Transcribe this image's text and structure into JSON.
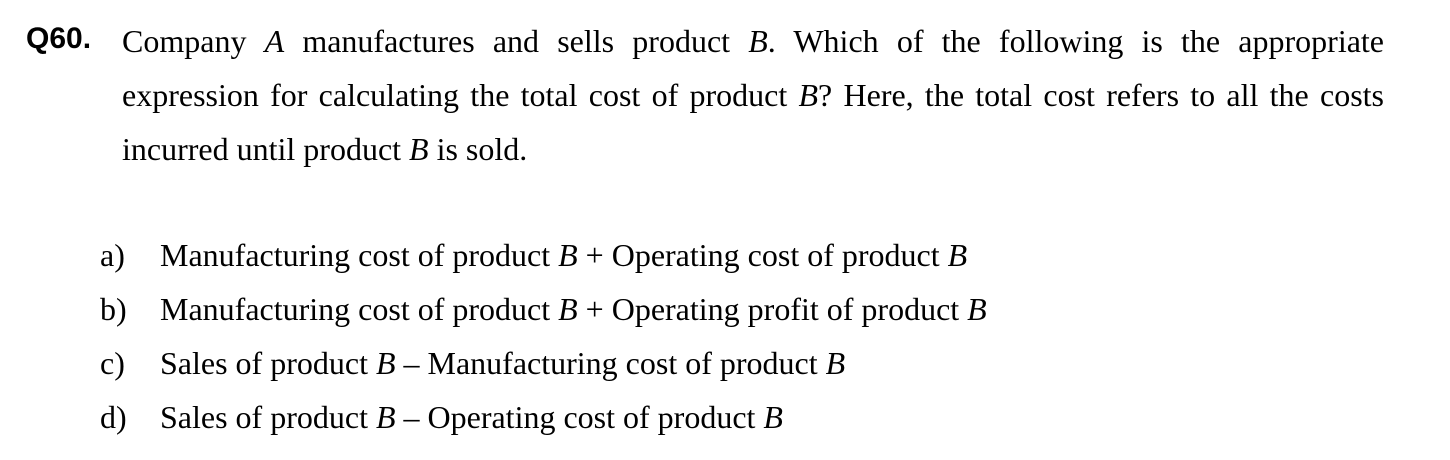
{
  "question": {
    "number": "Q60.",
    "stem_parts": [
      {
        "text": "Company ",
        "italic": false
      },
      {
        "text": "A",
        "italic": true
      },
      {
        "text": " manufactures and sells product ",
        "italic": false
      },
      {
        "text": "B",
        "italic": true
      },
      {
        "text": ".  Which of the following is the appropriate expression for calculating the total cost of product ",
        "italic": false
      },
      {
        "text": "B",
        "italic": true
      },
      {
        "text": "?  Here, the total cost refers to all the costs incurred until product ",
        "italic": false
      },
      {
        "text": "B",
        "italic": true
      },
      {
        "text": " is sold.",
        "italic": false
      }
    ]
  },
  "options": [
    {
      "label": "a)",
      "parts": [
        {
          "text": "Manufacturing cost of product ",
          "italic": false
        },
        {
          "text": "B",
          "italic": true
        },
        {
          "text": " + Operating cost of product ",
          "italic": false
        },
        {
          "text": "B",
          "italic": true
        }
      ]
    },
    {
      "label": "b)",
      "parts": [
        {
          "text": "Manufacturing cost of product ",
          "italic": false
        },
        {
          "text": "B",
          "italic": true
        },
        {
          "text": " + Operating profit of product ",
          "italic": false
        },
        {
          "text": "B",
          "italic": true
        }
      ]
    },
    {
      "label": "c)",
      "parts": [
        {
          "text": "Sales of product ",
          "italic": false
        },
        {
          "text": "B",
          "italic": true
        },
        {
          "text": " – Manufacturing cost of product ",
          "italic": false
        },
        {
          "text": "B",
          "italic": true
        }
      ]
    },
    {
      "label": "d)",
      "parts": [
        {
          "text": "Sales of product ",
          "italic": false
        },
        {
          "text": "B",
          "italic": true
        },
        {
          "text": " – Operating cost of product ",
          "italic": false
        },
        {
          "text": "B",
          "italic": true
        }
      ]
    }
  ]
}
